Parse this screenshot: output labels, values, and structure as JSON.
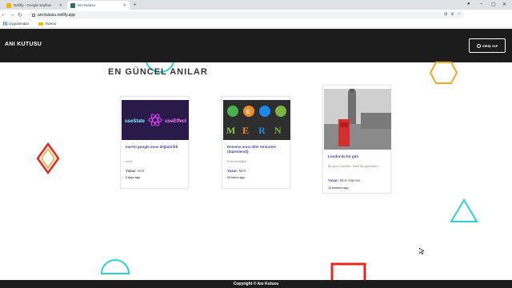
{
  "browser": {
    "tabs": [
      {
        "title": "Netlify - Google Sayfası",
        "active": false
      },
      {
        "title": "Anı Kutusu",
        "active": true
      }
    ],
    "url": "ani-kutusu.netlify.app",
    "bookmarks": [
      "Uygulamalar",
      "Videos"
    ]
  },
  "nav": {
    "brand": "ANI KUTUSU",
    "login_label": "GİRİŞ YAP"
  },
  "page": {
    "section_title": "EN GÜNCEL ANILAR",
    "footer": "Copyright © Anı Kutusu"
  },
  "cards": [
    {
      "title": "mertin google anısı değiştirildi",
      "desc": "mert",
      "author_label": "Yazar:",
      "author": "mert",
      "time": "2 days ago",
      "thumb_texts": [
        "useState",
        "useEffect"
      ]
    },
    {
      "title": "Deneme anısı after 6minutes (düzenlendi)",
      "desc": "Evet bebeğim",
      "author_label": "Yazar:",
      "author": "Mert",
      "time": "20 hours ago",
      "thumb_texts": [
        "E",
        "M",
        "E",
        "R",
        "N"
      ]
    },
    {
      "title": "Londra'da bir gün",
      "desc": "Bir gün Camden Town'da geziniken...",
      "author_label": "Yazar:",
      "author": "Mert Akpınar",
      "time": "13 minutes ago",
      "thumb_texts": []
    }
  ],
  "colors": {
    "navbar": "#1c1c1c",
    "accent": "#4a3fa0",
    "deco_orange": "#f5a623",
    "deco_cyan": "#29d3d3",
    "deco_red": "#e8261c"
  }
}
